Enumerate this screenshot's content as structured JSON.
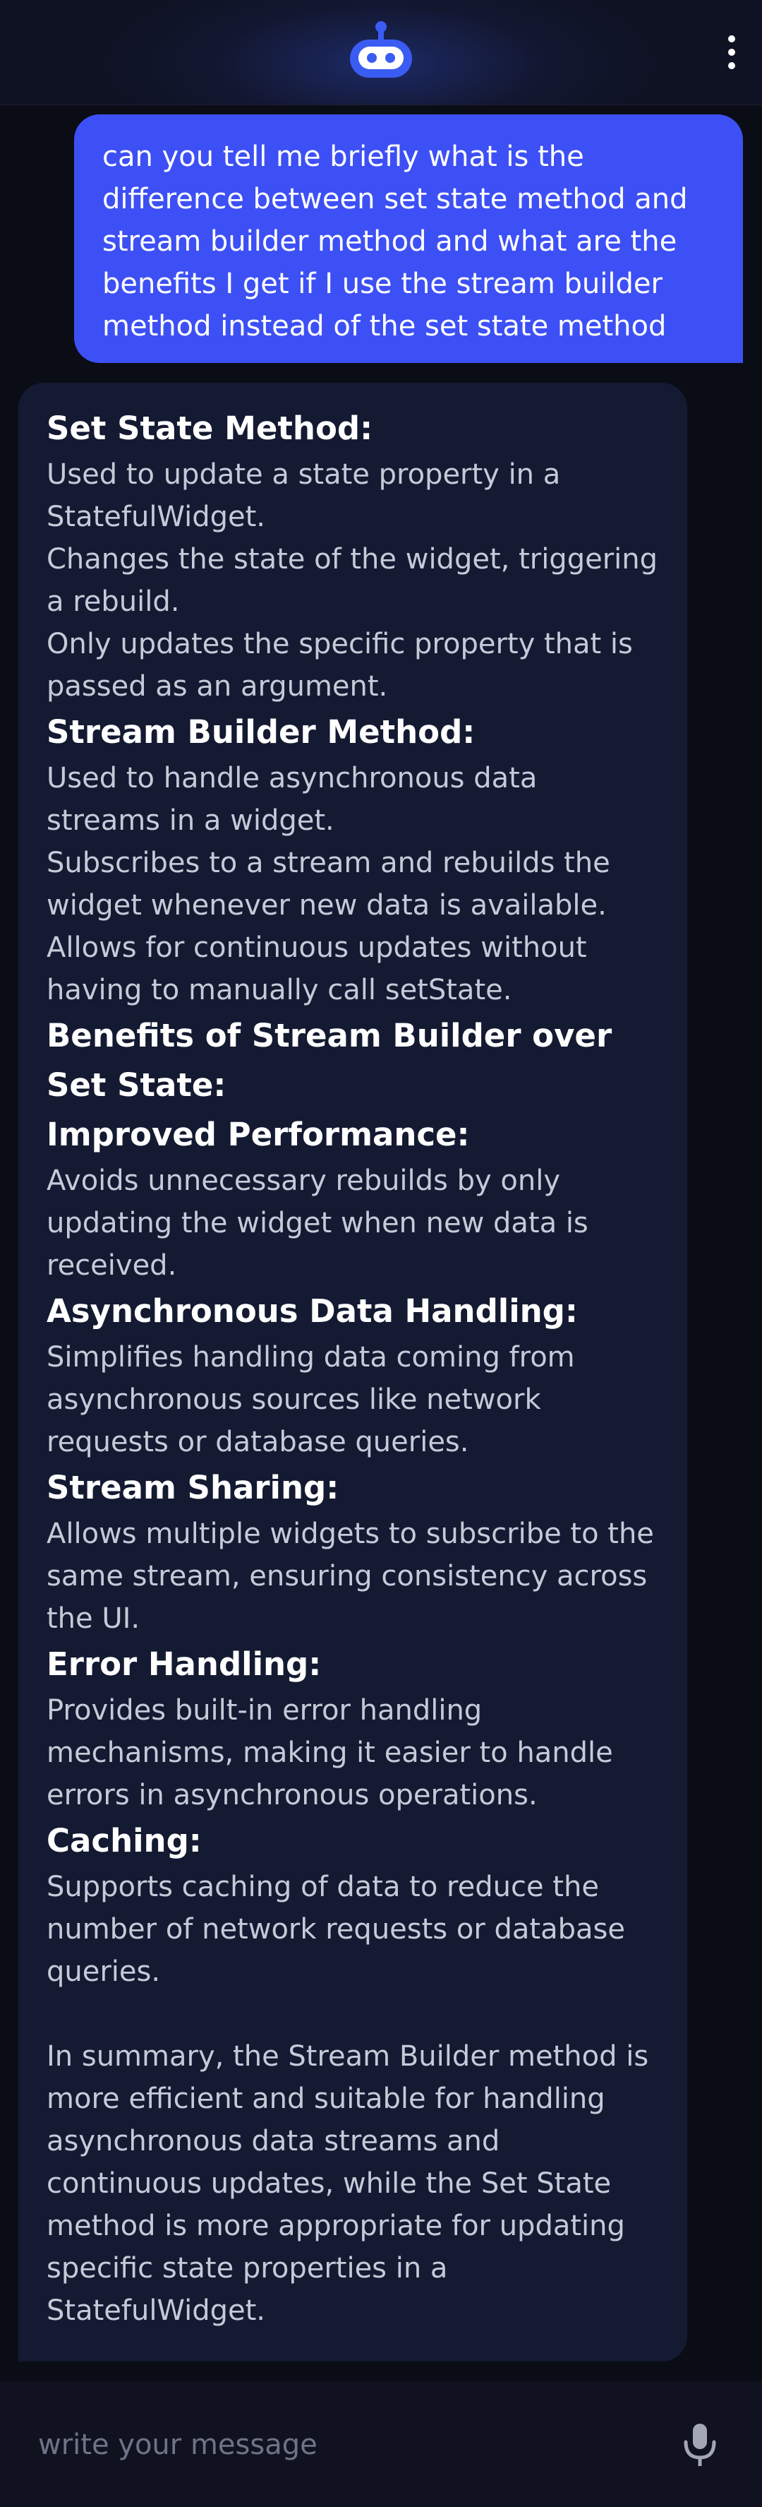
{
  "header": {
    "logo_icon": "robot-icon",
    "menu_icon": "more-vert-icon"
  },
  "chat": {
    "user_message": "can you tell me briefly what is the difference between set state method and stream builder method and what are the benefits I get if I use the stream builder method instead of the set state method",
    "bot_response": {
      "set_state_heading": "Set State Method:",
      "set_state_points": [
        "Used to update a state property in a StatefulWidget.",
        "Changes the state of the widget, triggering a rebuild.",
        "Only updates the specific property that is passed as an argument."
      ],
      "stream_builder_heading": "Stream Builder Method:",
      "stream_builder_points": [
        "Used to handle asynchronous data streams in a widget.",
        "Subscribes to a stream and rebuilds the widget whenever new data is available.",
        "Allows for continuous updates without having to manually call setState."
      ],
      "benefits_heading": "Benefits of Stream Builder over Set State:",
      "benefits": [
        {
          "title": "Improved Performance:",
          "text": "Avoids unnecessary rebuilds by only updating the widget when new data is received."
        },
        {
          "title": "Asynchronous Data Handling:",
          "text": "Simplifies handling data coming from asynchronous sources like network requests or database queries."
        },
        {
          "title": "Stream Sharing:",
          "text": "Allows multiple widgets to subscribe to the same stream, ensuring consistency across the UI."
        },
        {
          "title": "Error Handling:",
          "text": "Provides built-in error handling mechanisms, making it easier to handle errors in asynchronous operations."
        },
        {
          "title": "Caching:",
          "text": "Supports caching of data to reduce the number of network requests or database queries."
        }
      ],
      "summary": "In summary, the Stream Builder method is more efficient and suitable for handling asynchronous data streams and continuous updates, while the Set State method is more appropriate for updating specific state properties in a StatefulWidget."
    }
  },
  "composer": {
    "placeholder": "write your message",
    "value": "",
    "mic_icon": "microphone-icon"
  },
  "colors": {
    "background": "#0b0d16",
    "user_bubble": "#3d50f5",
    "bot_bubble": "#131a31",
    "accent_logo": "#3b5cf3"
  }
}
